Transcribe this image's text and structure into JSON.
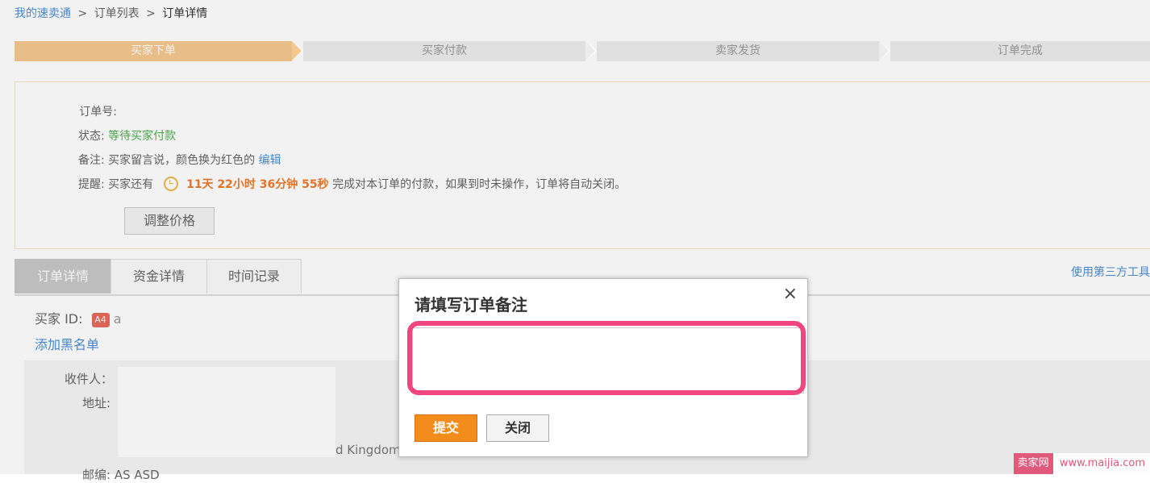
{
  "breadcrumb": {
    "home": "我的速卖通",
    "list": "订单列表",
    "current": "订单详情",
    "separator": ">"
  },
  "steps": [
    "买家下单",
    "买家付款",
    "卖家发货",
    "订单完成"
  ],
  "info": {
    "order_no_label": "订单号:",
    "status_label": "状态:",
    "status_value": "等待买家付款",
    "note_label": "备注:",
    "note_value": "买家留言说，颜色换为红色的",
    "note_edit": "编辑",
    "reminder_label": "提醒:",
    "reminder_prefix": "买家还有",
    "reminder_timer": "11天 22小时 36分钟 55秒",
    "reminder_suffix": "完成对本订单的付款，如果到时未操作，订单将自动关闭。",
    "adjust_price_button": "调整价格"
  },
  "tabs": [
    "订单详情",
    "资金详情",
    "时间记录"
  ],
  "third_party_link": "使用第三方工具",
  "buyer": {
    "id_label": "买家 ID:",
    "badge": "A4",
    "id_value": "a",
    "blacklist_link": "添加黑名单"
  },
  "address": {
    "recipient_label": "收件人：",
    "address_label": "地址:",
    "country_fragment": "d Kingdom",
    "postcode_label": "邮编:",
    "postcode_value": "AS ASD"
  },
  "modal": {
    "title": "请填写订单备注",
    "close_symbol": "×",
    "note_value": "",
    "submit_button": "提交",
    "close_button": "关闭"
  },
  "watermark": {
    "logo": "卖家网",
    "url": "www.maijia.com"
  },
  "colors": {
    "step_active": "#f6c88f",
    "status_green": "#4cae4c",
    "timer_orange": "#f07a2a",
    "link_blue": "#4a8fd6",
    "highlight_pink": "#f0457e",
    "submit_orange": "#f28c1c"
  }
}
